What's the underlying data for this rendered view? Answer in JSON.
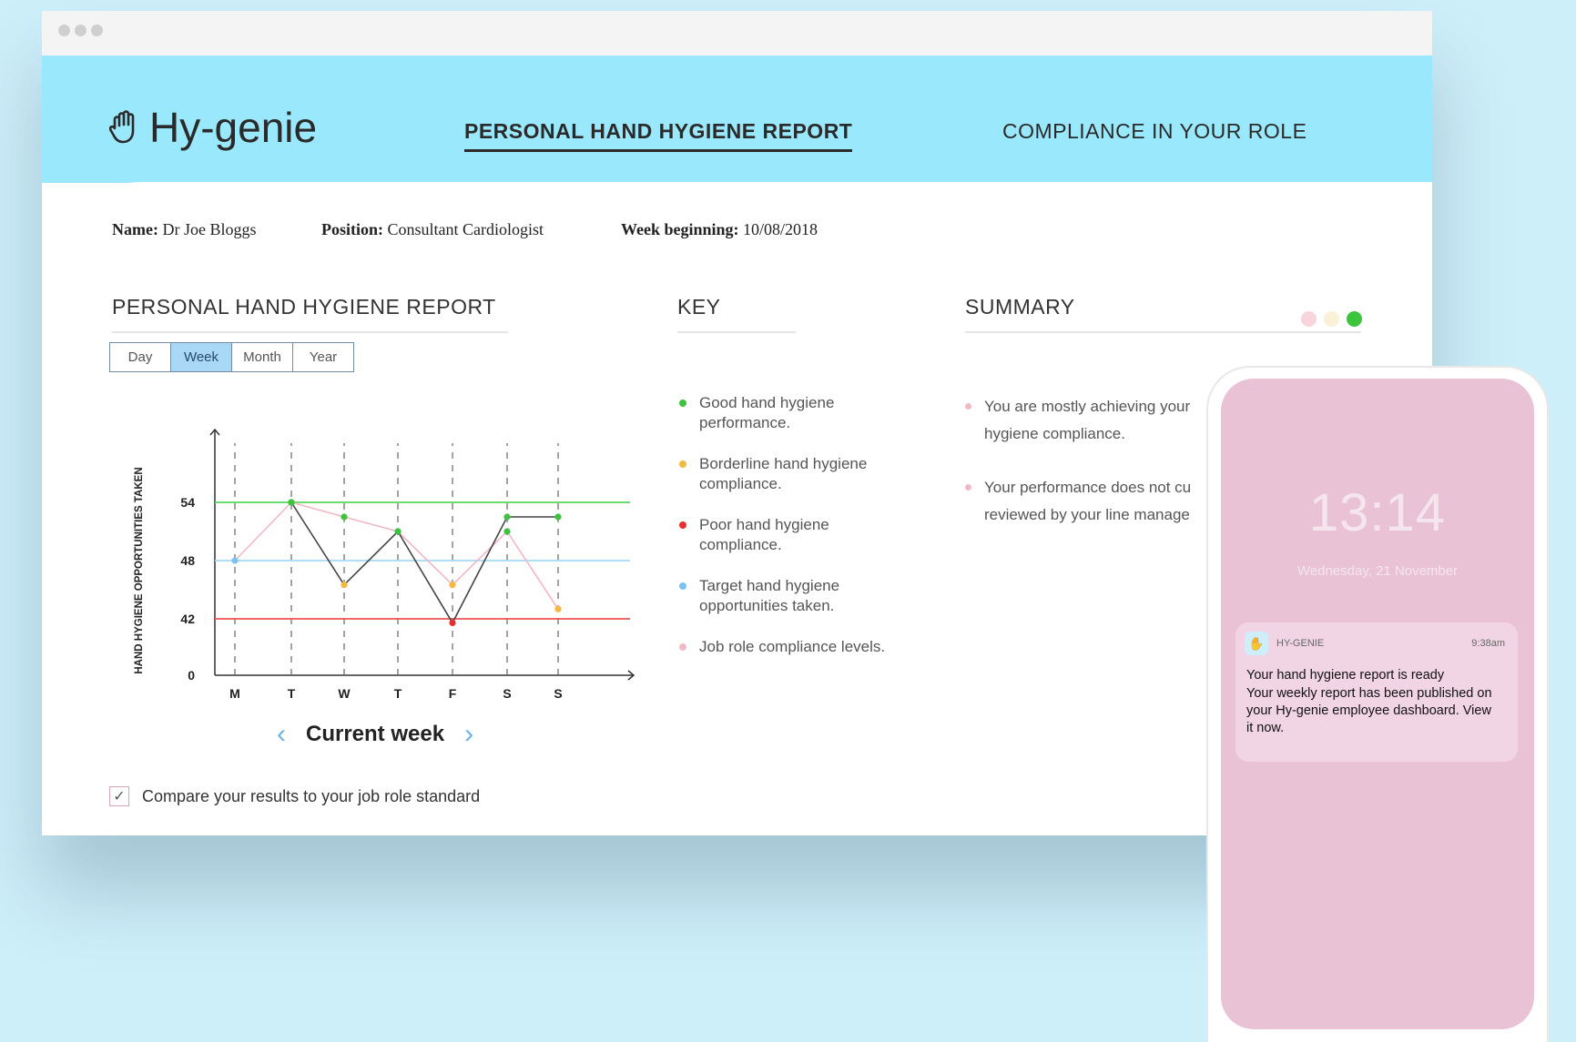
{
  "window": {
    "title_dots": [
      "dot",
      "dot",
      "dot"
    ]
  },
  "header": {
    "logo_text": "Hy-genie",
    "logo_icon": "hand-icon",
    "nav": [
      {
        "label": "PERSONAL HAND HYGIENE REPORT",
        "active": true
      },
      {
        "label": "COMPLIANCE IN YOUR ROLE",
        "active": false
      }
    ]
  },
  "meta": {
    "name_label": "Name:",
    "name_value": "Dr Joe Bloggs",
    "position_label": "Position:",
    "position_value": "Consultant Cardiologist",
    "week_label": "Week beginning:",
    "week_value": "10/08/2018"
  },
  "report": {
    "title": "PERSONAL HAND HYGIENE REPORT",
    "tabs": [
      "Day",
      "Week",
      "Month",
      "Year"
    ],
    "active_tab": "Week",
    "week_nav_label": "Current week",
    "compare_label": "Compare your results to your job role standard",
    "compare_checked": true
  },
  "chart_data": {
    "type": "line",
    "ylabel": "HAND HYGIENE OPPORTUNITIES TAKEN",
    "categories": [
      "M",
      "T",
      "W",
      "T",
      "F",
      "S",
      "S"
    ],
    "yticks": [
      0,
      42,
      48,
      54
    ],
    "reference_lines": [
      {
        "value": 54,
        "color": "#5cd65c"
      },
      {
        "value": 48,
        "color": "#a6d8f5"
      },
      {
        "value": 42,
        "color": "#ee5555"
      }
    ],
    "series": [
      {
        "values": [
          null,
          54,
          45.5,
          51,
          39,
          52.5,
          52.5
        ],
        "color": "#444444",
        "point_colors": [
          "",
          "#3cc43c",
          "#f5b942",
          "#3cc43c",
          "#e33030",
          "#3cc43c",
          "#3cc43c"
        ]
      },
      {
        "values": [
          48,
          54,
          52.5,
          51,
          45.5,
          51,
          43
        ],
        "color": "#f1b8c6",
        "point_colors": [
          "#7cc3f0",
          "#3cc43c",
          "#3cc43c",
          "#3cc43c",
          "#f5b942",
          "#3cc43c",
          "#f5b942"
        ]
      }
    ]
  },
  "key": {
    "title": "KEY",
    "items": [
      {
        "label": "Good hand hygiene performance.",
        "color": "#3cc43c"
      },
      {
        "label": "Borderline hand hygiene compliance.",
        "color": "#f5b942"
      },
      {
        "label": "Poor hand hygiene compliance.",
        "color": "#e33030"
      },
      {
        "label": "Target hand hygiene opportunities taken.",
        "color": "#7cc3f0"
      },
      {
        "label": "Job role compliance levels.",
        "color": "#f3b8c6"
      }
    ]
  },
  "summary": {
    "title": "SUMMARY",
    "status_dots": [
      "#f8d4dc",
      "#fbf0d8",
      "#3cc43c"
    ],
    "items": [
      "You are mostly achieving your hygiene compliance.",
      "Your performance does not cu reviewed by your line manage"
    ]
  },
  "phone": {
    "time": "13:14",
    "date": "Wednesday, 21 November",
    "notification": {
      "app": "HY-GENIE",
      "time": "9:38am",
      "title": "Your hand hygiene report is ready",
      "body": "Your weekly report has been published on your Hy-genie employee dashboard. View it now."
    }
  }
}
